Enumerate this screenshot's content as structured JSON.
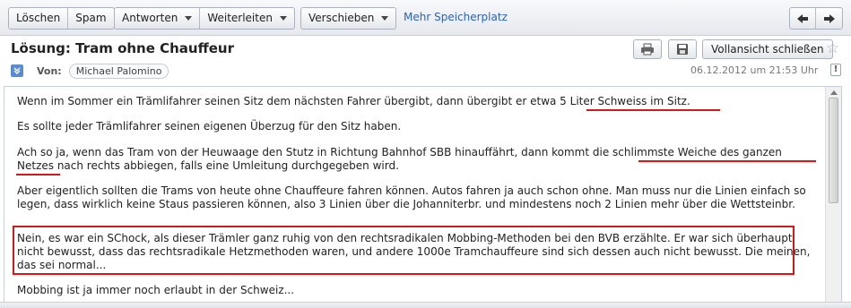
{
  "toolbar": {
    "delete_label": "Löschen",
    "spam_label": "Spam",
    "reply_label": "Antworten",
    "forward_label": "Weiterleiten",
    "move_label": "Verschieben",
    "more_storage_label": "Mehr Speicherplatz"
  },
  "header": {
    "subject": "Lösung: Tram ohne Chauffeur",
    "close_fullview_label": "Vollansicht schließen",
    "from_label": "Von:",
    "sender": "Michael Palomino",
    "date": "06.12.2012 um 21:53 Uhr"
  },
  "icons": {
    "print": "print-icon",
    "save": "save-icon",
    "star": "star-icon",
    "prev": "arrow-left-icon",
    "next": "arrow-right-icon",
    "expand": "expand-icon",
    "info": "info-icon"
  },
  "colors": {
    "link": "#2a64b6",
    "annotation": "#d31a1a"
  },
  "body": {
    "p1": "Wenn im Sommer ein Trämlifahrer seinen Sitz dem nächsten Fahrer übergibt, dann übergibt er etwa 5 Liter Schweiss im Sitz.",
    "p2": "Es sollte jeder Trämlifahrer seinen eigenen Überzug für den Sitz haben.",
    "p3": "Ach so ja, wenn das Tram von der Heuwaage den Stutz in Richtung Bahnhof SBB hinauffährt, dann kommt die schlimmste Weiche des ganzen Netzes nach rechts abbiegen, falls eine Umleitung durchgegeben wird.",
    "p4": "Aber eigentlich sollten die Trams von heute ohne Chauffeure fahren können. Autos fahren ja auch schon ohne. Man muss nur die Linien einfach so legen, dass wirklich keine Staus passieren können, also 3 Linien über die Johanniterbr. und mindestens noch 2 Linien mehr über die Wettsteinbr.",
    "p5": "Nein, es war ein SChock, als dieser Trämler ganz ruhig von den rechtsradikalen Mobbing-Methoden bei den BVB erzählte. Er war sich überhaupt nicht bewusst, dass das rechtsradikale Hetzmethoden waren, und andere 1000e Tramchauffeure sind sich dessen auch nicht bewusst. Die meinen, das sei normal...",
    "p6": "Mobbing ist ja immer noch erlaubt in der Schweiz..."
  }
}
